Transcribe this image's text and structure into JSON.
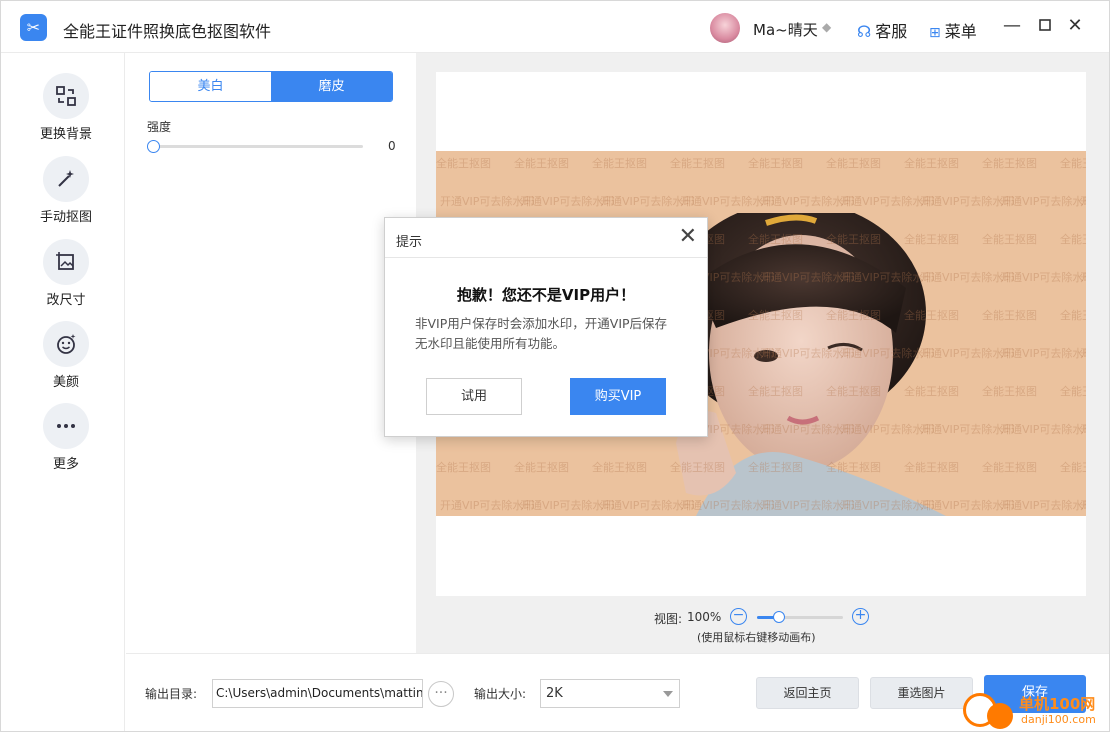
{
  "app": {
    "title": "全能王证件照换底色抠图软件",
    "user_name": "Ma~晴天",
    "service_label": "客服",
    "menu_label": "菜单",
    "accent_color": "#3a86f0"
  },
  "sidebar": {
    "items": [
      {
        "label": "更换背景",
        "icon": "replace-background-icon"
      },
      {
        "label": "手动抠图",
        "icon": "magic-wand-icon"
      },
      {
        "label": "改尺寸",
        "icon": "crop-resize-icon"
      },
      {
        "label": "美颜",
        "icon": "beauty-face-icon"
      },
      {
        "label": "更多",
        "icon": "more-dots-icon"
      }
    ]
  },
  "panel": {
    "tabs": [
      {
        "label": "美白",
        "selected": false
      },
      {
        "label": "磨皮",
        "selected": true
      }
    ],
    "strength_label": "强度",
    "strength_value": "0"
  },
  "preview": {
    "watermark_brand": "全能王抠图",
    "watermark_vip": "开通VIP可去除水印",
    "background_color": "#ebc29e",
    "zoom_label": "视图:",
    "zoom_value": "100%",
    "zoom_level": 0.25,
    "zoom_hint": "(使用鼠标右键移动画布)"
  },
  "bottom": {
    "output_dir_label": "输出目录:",
    "output_dir_value": "C:\\Users\\admin\\Documents\\matting",
    "output_size_label": "输出大小:",
    "output_size_value": "2K",
    "back_home": "返回主页",
    "reselect": "重选图片",
    "save": "保存"
  },
  "modal": {
    "title": "提示",
    "heading": "抱歉！您还不是VIP用户！",
    "body": "非VIP用户保存时会添加水印，开通VIP后保存无水印且能使用所有功能。",
    "trial": "试用",
    "buy": "购买VIP"
  },
  "brand_badge": {
    "title": "单机100网",
    "url": "danji100.com"
  }
}
